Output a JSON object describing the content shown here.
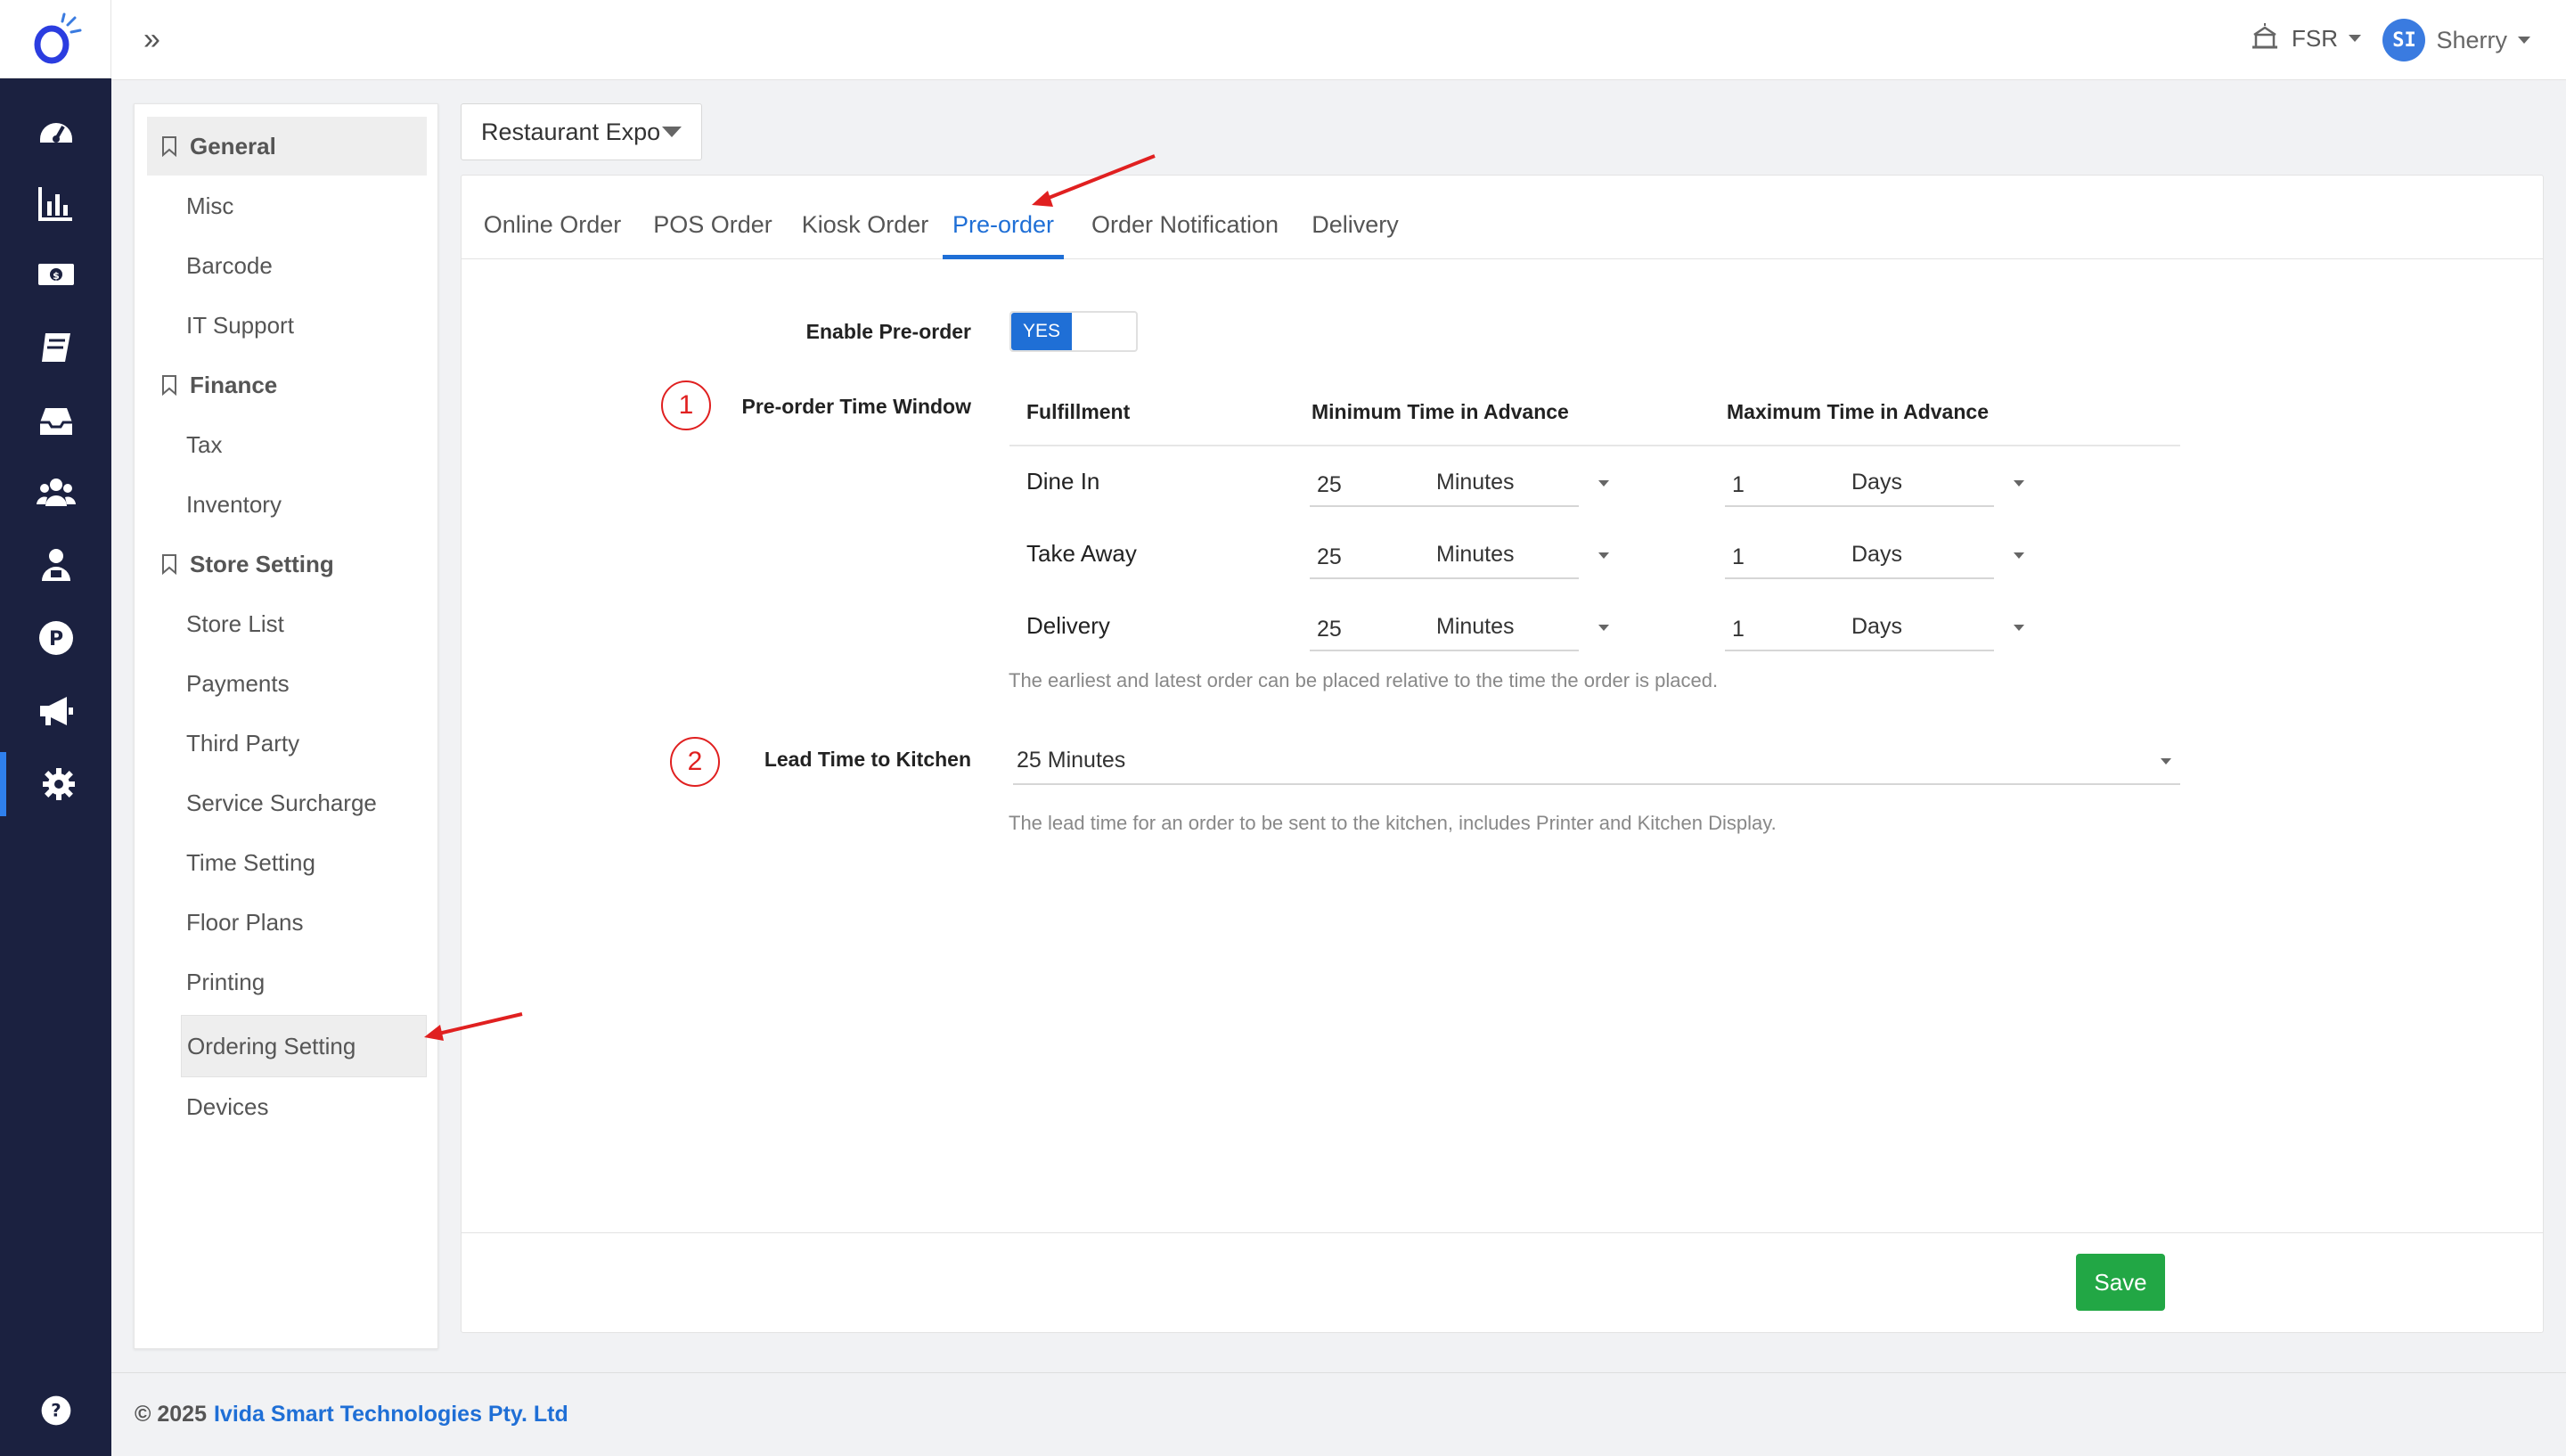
{
  "topbar": {
    "store_code": "FSR",
    "user_initials": "SI",
    "user_name": "Sherry"
  },
  "rail": {
    "icons": [
      "dashboard-icon",
      "reports-chart-icon",
      "cash-icon",
      "book-icon",
      "inbox-icon",
      "users-icon",
      "staff-icon",
      "points-icon",
      "megaphone-icon",
      "settings-gear-icon"
    ],
    "active_index": 9,
    "help_icon": "help-icon"
  },
  "sidemenu": {
    "groups": [
      {
        "label": "General",
        "items": [
          "Misc",
          "Barcode",
          "IT Support"
        ]
      },
      {
        "label": "Finance",
        "items": [
          "Tax",
          "Inventory"
        ]
      },
      {
        "label": "Store Setting",
        "items": [
          "Store List",
          "Payments",
          "Third Party",
          "Service Surcharge",
          "Time Setting",
          "Floor Plans",
          "Printing",
          "Ordering Setting",
          "Devices"
        ]
      }
    ],
    "active_item": "Ordering Setting"
  },
  "store_dropdown": {
    "value": "Restaurant Expo"
  },
  "tabs": [
    "Online Order",
    "POS Order",
    "Kiosk Order",
    "Pre-order",
    "Order Notification",
    "Delivery"
  ],
  "active_tab": "Pre-order",
  "preorder": {
    "enable_label": "Enable Pre-order",
    "enable_value": "YES",
    "window_label": "Pre-order Time Window",
    "marker_1": "1",
    "columns": [
      "Fulfillment",
      "Minimum Time in Advance",
      "Maximum Time in Advance"
    ],
    "rows": [
      {
        "fulfillment": "Dine In",
        "min_value": "25",
        "min_unit": "Minutes",
        "max_value": "1",
        "max_unit": "Days"
      },
      {
        "fulfillment": "Take Away",
        "min_value": "25",
        "min_unit": "Minutes",
        "max_value": "1",
        "max_unit": "Days"
      },
      {
        "fulfillment": "Delivery",
        "min_value": "25",
        "min_unit": "Minutes",
        "max_value": "1",
        "max_unit": "Days"
      }
    ],
    "window_help": "The earliest and latest order can be placed relative to the time the order is placed.",
    "lead_label": "Lead Time to Kitchen",
    "marker_2": "2",
    "lead_value": "25 Minutes",
    "lead_help": "The lead time for an order to be sent to the kitchen, includes Printer and Kitchen Display."
  },
  "save_label": "Save",
  "footer": {
    "copyright": "© 2025",
    "company": "Ivida Smart Technologies Pty. Ltd"
  },
  "colors": {
    "accent": "#1f6fd6",
    "rail": "#1b2140",
    "save": "#22a745",
    "annotation": "#e02020"
  }
}
